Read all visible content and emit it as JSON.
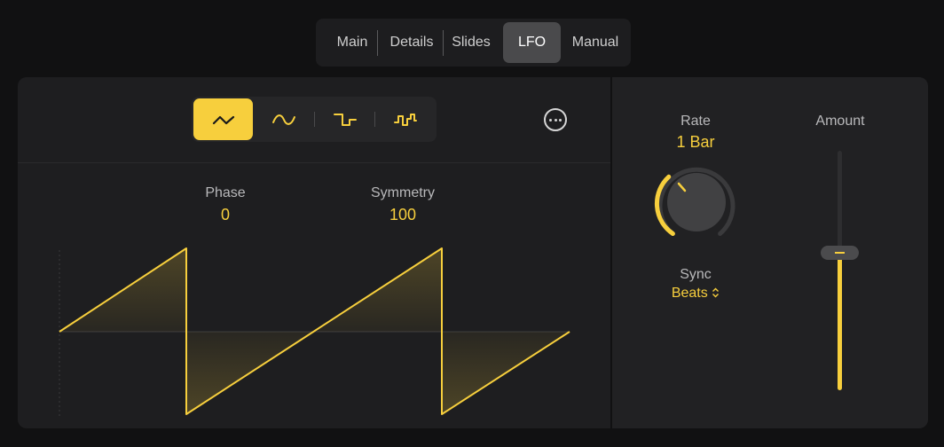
{
  "tabs": [
    {
      "label": "Main",
      "active": false
    },
    {
      "label": "Details",
      "active": false
    },
    {
      "label": "Slides",
      "active": false
    },
    {
      "label": "LFO",
      "active": true
    },
    {
      "label": "Manual",
      "active": false
    }
  ],
  "waveforms": [
    {
      "icon": "triangle-wave-icon",
      "selected": true
    },
    {
      "icon": "sine-wave-icon",
      "selected": false
    },
    {
      "icon": "square-wave-icon",
      "selected": false
    },
    {
      "icon": "random-wave-icon",
      "selected": false
    }
  ],
  "more_icon": "ellipsis-circle-icon",
  "phase": {
    "label": "Phase",
    "value": "0"
  },
  "symmetry": {
    "label": "Symmetry",
    "value": "100"
  },
  "rate": {
    "label": "Rate",
    "value": "1 Bar"
  },
  "sync": {
    "label": "Sync",
    "value": "Beats",
    "chevron": "⌃⌄"
  },
  "amount": {
    "label": "Amount",
    "level": 0.57
  },
  "colors": {
    "accent": "#f7cf3d",
    "panel": "#1e1e20",
    "background": "#111112"
  }
}
